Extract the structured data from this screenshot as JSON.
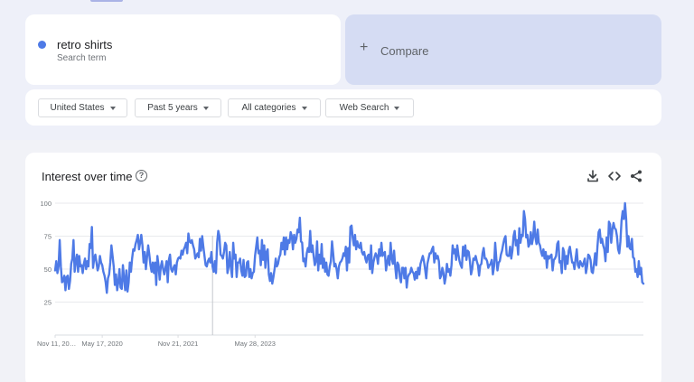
{
  "search_term": {
    "name": "retro shirts",
    "subtitle": "Search term",
    "dot_color": "#4e7ae6"
  },
  "compare": {
    "plus": "+",
    "label": "Compare"
  },
  "filters": [
    {
      "label": "United States"
    },
    {
      "label": "Past 5 years"
    },
    {
      "label": "All categories"
    },
    {
      "label": "Web Search"
    }
  ],
  "chart_card": {
    "title": "Interest over time",
    "help_glyph": "?"
  },
  "toolbar": {
    "download_icon": "download-icon",
    "embed_icon": "embed-code-icon",
    "share_icon": "share-icon"
  },
  "chart_data": {
    "type": "line",
    "title": "",
    "xlabel": "",
    "ylabel": "",
    "ylim": [
      0,
      100
    ],
    "y_ticks": [
      25,
      50,
      75,
      100
    ],
    "x_tick_labels": [
      "Nov 11, 20…",
      "May 17, 2020",
      "Nov 21, 2021",
      "May 28, 2023"
    ],
    "x_tick_positions": [
      0,
      41,
      107,
      174
    ],
    "grid": true,
    "line_color": "#4e7ae6",
    "annotation_marker_index": 137,
    "series": [
      {
        "values": [
          49,
          56,
          47,
          52,
          72,
          52,
          40,
          41,
          45,
          34,
          44,
          45,
          35,
          41,
          54,
          58,
          72,
          48,
          56,
          61,
          48,
          60,
          52,
          53,
          47,
          54,
          58,
          50,
          56,
          52,
          69,
          66,
          82,
          51,
          58,
          61,
          55,
          49,
          52,
          60,
          55,
          53,
          48,
          45,
          40,
          32,
          43,
          46,
          55,
          68,
          60,
          52,
          38,
          46,
          34,
          40,
          50,
          36,
          35,
          53,
          43,
          34,
          49,
          33,
          40,
          55,
          48,
          58,
          65,
          64,
          69,
          72,
          76,
          65,
          70,
          76,
          68,
          55,
          63,
          50,
          59,
          68,
          61,
          53,
          48,
          55,
          47,
          55,
          38,
          60,
          53,
          42,
          52,
          56,
          50,
          46,
          51,
          56,
          40,
          57,
          61,
          50,
          48,
          51,
          53,
          46,
          55,
          58,
          59,
          58,
          64,
          61,
          65,
          67,
          70,
          62,
          77,
          71,
          70,
          72,
          68,
          65,
          58,
          60,
          62,
          59,
          73,
          64,
          75,
          67,
          60,
          53,
          52,
          56,
          58,
          55,
          63,
          52,
          48,
          56,
          47,
          70,
          79,
          75,
          61,
          60,
          58,
          63,
          70,
          68,
          47,
          52,
          63,
          51,
          44,
          70,
          58,
          61,
          44,
          55,
          55,
          58,
          49,
          45,
          57,
          44,
          45,
          55,
          56,
          44,
          50,
          43,
          47,
          48,
          60,
          67,
          74,
          62,
          64,
          53,
          72,
          57,
          68,
          51,
          63,
          65,
          46,
          41,
          47,
          39,
          44,
          50,
          58,
          52,
          54,
          59,
          61,
          70,
          65,
          74,
          61,
          74,
          65,
          72,
          70,
          78,
          75,
          65,
          76,
          70,
          73,
          80,
          78,
          89,
          71,
          70,
          56,
          58,
          52,
          62,
          66,
          63,
          79,
          63,
          68,
          60,
          53,
          56,
          71,
          49,
          61,
          54,
          69,
          51,
          58,
          48,
          55,
          46,
          45,
          52,
          56,
          71,
          62,
          52,
          54,
          50,
          43,
          52,
          55,
          56,
          58,
          62,
          60,
          67,
          49,
          66,
          55,
          82,
          83,
          74,
          68,
          76,
          65,
          71,
          67,
          66,
          70,
          63,
          61,
          63,
          58,
          55,
          60,
          61,
          50,
          68,
          47,
          55,
          59,
          62,
          60,
          54,
          65,
          60,
          70,
          60,
          62,
          63,
          49,
          55,
          60,
          53,
          70,
          58,
          54,
          64,
          52,
          43,
          55,
          53,
          44,
          40,
          51,
          51,
          43,
          51,
          36,
          44,
          46,
          47,
          51,
          48,
          47,
          42,
          48,
          43,
          51,
          46,
          54,
          57,
          60,
          56,
          50,
          43,
          54,
          58,
          62,
          62,
          65,
          67,
          55,
          62,
          58,
          60,
          56,
          43,
          45,
          51,
          47,
          39,
          44,
          54,
          48,
          50,
          45,
          53,
          68,
          62,
          65,
          57,
          68,
          61,
          56,
          53,
          51,
          67,
          60,
          68,
          57,
          64,
          63,
          56,
          46,
          50,
          58,
          57,
          60,
          56,
          53,
          45,
          53,
          54,
          62,
          66,
          58,
          58,
          56,
          51,
          53,
          54,
          57,
          46,
          52,
          70,
          58,
          49,
          55,
          56,
          61,
          64,
          69,
          73,
          75,
          61,
          60,
          60,
          67,
          58,
          64,
          75,
          79,
          68,
          72,
          61,
          81,
          70,
          76,
          75,
          94,
          88,
          74,
          76,
          67,
          69,
          78,
          69,
          74,
          86,
          74,
          69,
          80,
          70,
          68,
          63,
          60,
          65,
          58,
          63,
          51,
          60,
          58,
          60,
          61,
          49,
          57,
          58,
          60,
          69,
          71,
          55,
          56,
          47,
          66,
          63,
          50,
          60,
          54,
          64,
          67,
          61,
          55,
          55,
          50,
          58,
          65,
          53,
          51,
          56,
          54,
          52,
          55,
          58,
          47,
          52,
          61,
          60,
          57,
          48,
          47,
          54,
          62,
          53,
          67,
          78,
          80,
          70,
          73,
          68,
          65,
          56,
          74,
          63,
          86,
          84,
          70,
          80,
          85,
          81,
          80,
          75,
          65,
          62,
          71,
          87,
          94,
          88,
          100,
          88,
          67,
          75,
          66,
          65,
          73,
          59,
          58,
          48,
          50,
          44,
          56,
          46,
          51,
          40,
          39
        ]
      }
    ]
  }
}
